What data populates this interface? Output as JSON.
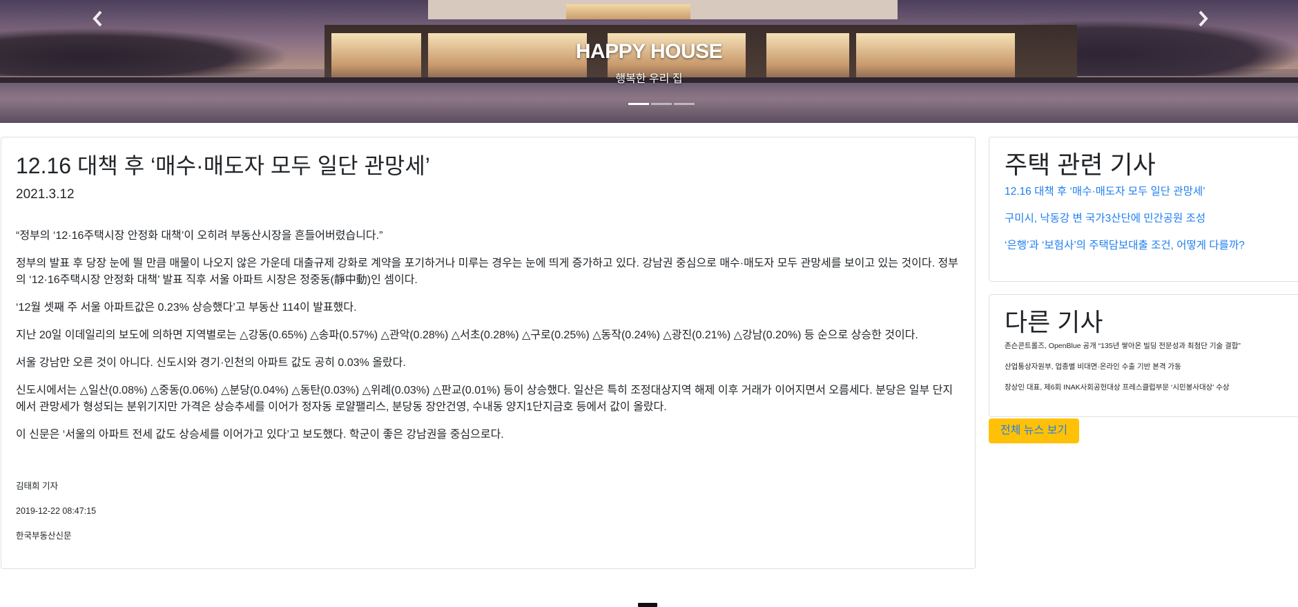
{
  "hero": {
    "title": "HAPPY HOUSE",
    "subtitle": "행복한 우리 집",
    "prev_icon": "chevron-left-icon",
    "next_icon": "chevron-right-icon",
    "indicator_count": 3,
    "active_indicator": 0
  },
  "article": {
    "title": "12.16 대책 후 ‘매수·매도자 모두 일단 관망세’",
    "date": "2021.3.12",
    "paragraphs": [
      "“정부의 ‘12·16주택시장 안정화 대책’이 오히려 부동산시장을 흔들어버렸습니다.”",
      "정부의 발표 후 당장 눈에 띌 만큼 매물이 나오지 않은 가운데 대출규제 강화로 계약을 포기하거나 미루는 경우는 눈에 띄게 증가하고 있다. 강남권 중심으로 매수·매도자 모두 관망세를 보이고 있는 것이다. 정부의 ‘12·16주택시장 안정화 대책’ 발표 직후 서울 아파트 시장은 정중동(靜中動)인 셈이다.",
      "‘12월 셋째 주 서울 아파트값은 0.23% 상승했다’고 부동산 114이 발표했다.",
      "지난 20일 이데일리의 보도에 의하면 지역별로는 △강동(0.65%) △송파(0.57%) △관악(0.28%) △서초(0.28%) △구로(0.25%) △동작(0.24%) △광진(0.21%) △강남(0.20%) 등 순으로 상승한 것이다.",
      "서울 강남만 오른 것이 아니다. 신도시와 경기·인천의 아파트 값도 공히 0.03% 올랐다.",
      "신도시에서는 △일산(0.08%) △중동(0.06%) △분당(0.04%) △동탄(0.03%) △위례(0.03%) △판교(0.01%) 등이 상승했다. 일산은 특히 조정대상지역 해제 이후 거래가 이어지면서 오름세다. 분당은 일부 단지에서 관망세가 형성되는 분위기지만 가격은 상승추세를 이어가 정자동 로얄팰리스, 분당동 장안건영, 수내동 양지1단지금호 등에서 값이 올랐다.",
      "이 신문은 ‘서울의 아파트 전세 값도 상승세를 이어가고 있다’고 보도했다. 학군이 좋은 강남권을 중심으로다."
    ],
    "reporter": "김태희 기자",
    "datetime": "2019-12-22 08:47:15",
    "source": "한국부동산신문"
  },
  "related": {
    "title": "주택 관련 기사",
    "links": [
      "12.16 대책 후 ‘매수·매도자 모두 일단 관망세’",
      "구미시, 낙동강 변 국가3산단에 민간공원 조성",
      "‘은행’과 ‘보험사’의 주택담보대출 조건, 어떻게 다를까?"
    ]
  },
  "other": {
    "title": "다른 기사",
    "items": [
      "존슨콘트롤즈, OpenBlue 공개 “135년 쌓아온 빌딩 전문성과 최첨단 기술 결합”",
      "산업통상자원부, 업종별 비대면·온라인 수출 기반 본격 가동",
      "장상인 대표, 제6회 INAK사회공헌대상 프레스클럽부문 ‘시민봉사대상’ 수상"
    ],
    "button_label": "전체 뉴스 보기"
  },
  "footer": {
    "icon": "square-icon"
  },
  "colors": {
    "link": "#1e7ef0",
    "button_bg": "#ffc107"
  }
}
